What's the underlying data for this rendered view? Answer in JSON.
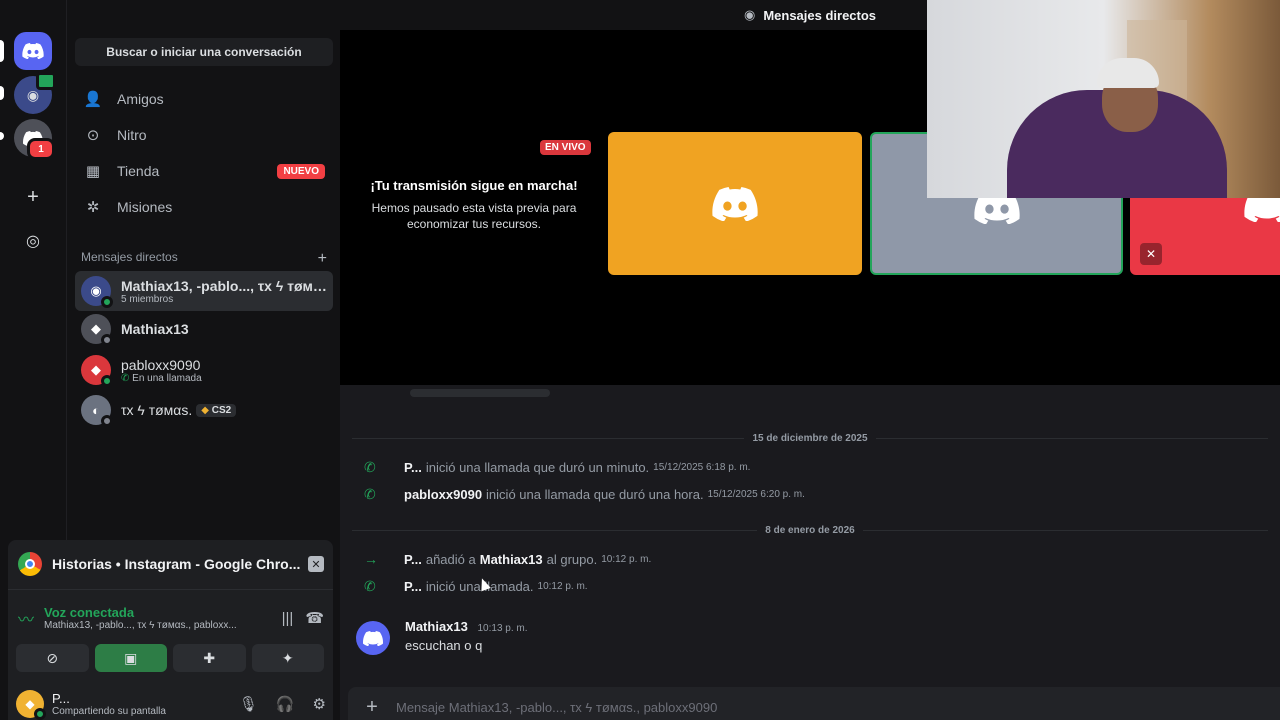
{
  "rail": {
    "badge_count": "1",
    "icons": [
      "discord-home-icon",
      "group-server-icon",
      "discord-server-icon",
      "add-server-icon",
      "explore-icon"
    ]
  },
  "sidebar": {
    "search_label": "Buscar o iniciar una conversación",
    "nav": [
      {
        "label": "Amigos",
        "icon": "friends-icon"
      },
      {
        "label": "Nitro",
        "icon": "nitro-icon"
      },
      {
        "label": "Tienda",
        "icon": "shop-icon",
        "badge": "NUEVO"
      },
      {
        "label": "Misiones",
        "icon": "quests-icon"
      }
    ],
    "dm_header": "Mensajes directos",
    "dms": [
      {
        "name": "Mathiax13, -pablo..., τх ϟ тøмαѕ...",
        "sub": "5 miembros"
      },
      {
        "name": "Mathiax13",
        "sub": ""
      },
      {
        "name": "pabloxx9090",
        "sub": "En una llamada"
      },
      {
        "name": "τх ϟ тøмαѕ.",
        "sub": "",
        "tag": "CS2"
      }
    ]
  },
  "panel": {
    "stream_title": "Historias • Instagram - Google Chro...",
    "voice_title": "Voz conectada",
    "voice_sub": "Mathiax13, -pablo..., τх ϟ тøмαѕ., pabloxx...",
    "user_name": "P...",
    "user_sub": "Compartiendo su pantalla"
  },
  "main": {
    "topbar_title": "Mensajes directos",
    "live_badge": "EN VIVO",
    "paused_title": "¡Tu transmisión sigue en marcha!",
    "paused_desc": "Hemos pausado esta vista previa para economizar tus recursos."
  },
  "chat": {
    "date1": "15 de diciembre de 2025",
    "date2": "8 de enero de 2026",
    "events": [
      {
        "who": "P...",
        "msg": "inició una llamada que duró un minuto.",
        "ts": "15/12/2025 6:18 p. m."
      },
      {
        "who": "pabloxx9090",
        "msg": "inició una llamada que duró una hora.",
        "ts": "15/12/2025 6:20 p. m."
      },
      {
        "who": "P...",
        "msg": "añadió a",
        "target": "Mathiax13",
        "msg2": "al grupo.",
        "ts": "10:12 p. m."
      },
      {
        "who": "P...",
        "msg": "inició una llamada.",
        "ts": "10:12 p. m."
      }
    ],
    "message": {
      "author": "Mathiax13",
      "time": "10:13 p. m.",
      "body": "escuchan o q"
    },
    "composer_placeholder": "Mensaje Mathiax13, -pablo..., τх ϟ тøмαѕ., pabloxx9090"
  }
}
